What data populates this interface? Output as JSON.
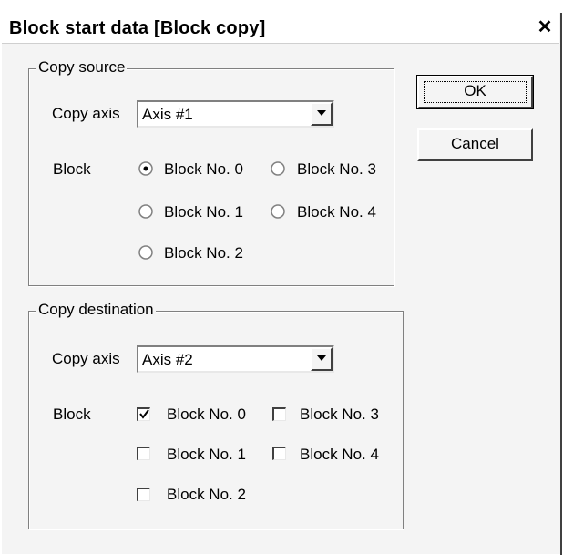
{
  "window": {
    "title": "Block start data [Block copy]",
    "close_glyph": "✕"
  },
  "buttons": {
    "ok": "OK",
    "cancel": "Cancel"
  },
  "source": {
    "legend": "Copy source",
    "copy_axis_label": "Copy axis",
    "axis_value": "Axis #1",
    "block_label": "Block",
    "options": [
      {
        "label": "Block No. 0",
        "selected": true
      },
      {
        "label": "Block No. 3",
        "selected": false
      },
      {
        "label": "Block No. 1",
        "selected": false
      },
      {
        "label": "Block No. 4",
        "selected": false
      },
      {
        "label": "Block No. 2",
        "selected": false
      }
    ]
  },
  "destination": {
    "legend": "Copy destination",
    "copy_axis_label": "Copy axis",
    "axis_value": "Axis #2",
    "block_label": "Block",
    "options": [
      {
        "label": "Block No. 0",
        "checked": true
      },
      {
        "label": "Block No. 3",
        "checked": false
      },
      {
        "label": "Block No. 1",
        "checked": false
      },
      {
        "label": "Block No. 4",
        "checked": false
      },
      {
        "label": "Block No. 2",
        "checked": false
      }
    ]
  }
}
